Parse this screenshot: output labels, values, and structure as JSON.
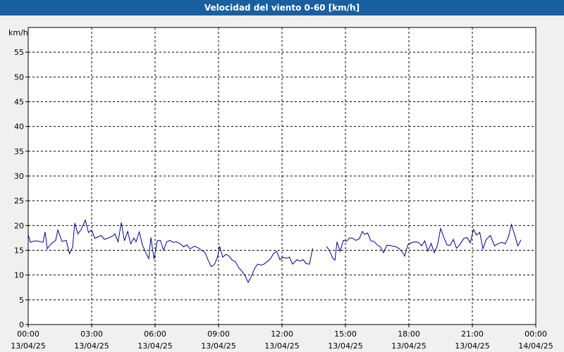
{
  "window": {
    "title": "Velocidad del viento 0-60 [km/h]"
  },
  "colors": {
    "title_bar": "#1a5fa0",
    "plot_bg": "#ffffff",
    "page_bg": "#f0f0f0",
    "series": "#00008b",
    "grid": "#000000"
  },
  "chart_data": {
    "type": "line",
    "title": "Velocidad del viento 0-60 [km/h]",
    "ylabel": "km/h",
    "ylim": [
      0,
      60
    ],
    "yticks": [
      0,
      5,
      10,
      15,
      20,
      25,
      30,
      35,
      40,
      45,
      50,
      55
    ],
    "xlim": [
      0,
      24
    ],
    "xticks": [
      {
        "time": "00:00",
        "date": "13/04/25"
      },
      {
        "time": "03:00",
        "date": "13/04/25"
      },
      {
        "time": "06:00",
        "date": "13/04/25"
      },
      {
        "time": "09:00",
        "date": "13/04/25"
      },
      {
        "time": "12:00",
        "date": "13/04/25"
      },
      {
        "time": "15:00",
        "date": "13/04/25"
      },
      {
        "time": "18:00",
        "date": "13/04/25"
      },
      {
        "time": "21:00",
        "date": "13/04/25"
      },
      {
        "time": "00:00",
        "date": "14/04/25"
      }
    ],
    "grid": true,
    "series": [
      {
        "segments": [
          [
            [
              0.0,
              18.2
            ],
            [
              0.1,
              16.6
            ],
            [
              0.3,
              16.9
            ],
            [
              0.5,
              16.8
            ],
            [
              0.7,
              16.6
            ],
            [
              0.8,
              18.7
            ],
            [
              0.9,
              15.3
            ],
            [
              1.1,
              16.4
            ],
            [
              1.3,
              17.0
            ],
            [
              1.4,
              19.1
            ],
            [
              1.6,
              16.8
            ],
            [
              1.8,
              17.0
            ],
            [
              1.95,
              14.3
            ],
            [
              2.1,
              15.6
            ],
            [
              2.2,
              20.5
            ],
            [
              2.35,
              18.3
            ],
            [
              2.5,
              19.2
            ],
            [
              2.7,
              21.1
            ],
            [
              2.85,
              18.6
            ],
            [
              3.0,
              19.1
            ],
            [
              3.15,
              17.4
            ],
            [
              3.3,
              17.7
            ],
            [
              3.45,
              18.0
            ],
            [
              3.6,
              17.2
            ],
            [
              3.8,
              17.5
            ],
            [
              4.0,
              17.9
            ],
            [
              4.1,
              18.3
            ],
            [
              4.25,
              16.7
            ],
            [
              4.4,
              20.6
            ],
            [
              4.55,
              16.9
            ],
            [
              4.7,
              18.8
            ],
            [
              4.85,
              16.3
            ],
            [
              5.0,
              17.5
            ],
            [
              5.1,
              16.7
            ],
            [
              5.25,
              18.7
            ],
            [
              5.4,
              16.1
            ],
            [
              5.55,
              14.6
            ],
            [
              5.7,
              13.3
            ],
            [
              5.8,
              17.6
            ],
            [
              5.95,
              13.2
            ],
            [
              6.1,
              16.9
            ],
            [
              6.25,
              17.0
            ],
            [
              6.4,
              15.0
            ],
            [
              6.55,
              16.7
            ],
            [
              6.7,
              17.0
            ],
            [
              6.85,
              16.6
            ],
            [
              7.0,
              16.7
            ],
            [
              7.2,
              16.3
            ],
            [
              7.35,
              15.7
            ],
            [
              7.5,
              16.1
            ],
            [
              7.65,
              15.3
            ],
            [
              7.85,
              15.8
            ],
            [
              8.0,
              15.6
            ],
            [
              8.2,
              15.0
            ],
            [
              8.35,
              14.6
            ],
            [
              8.5,
              13.1
            ],
            [
              8.65,
              11.7
            ],
            [
              8.8,
              12.1
            ],
            [
              8.95,
              13.6
            ],
            [
              9.05,
              15.8
            ],
            [
              9.2,
              13.6
            ],
            [
              9.35,
              14.2
            ],
            [
              9.5,
              13.8
            ],
            [
              9.65,
              13.0
            ],
            [
              9.8,
              12.7
            ],
            [
              9.95,
              11.5
            ],
            [
              10.1,
              10.8
            ],
            [
              10.25,
              9.9
            ],
            [
              10.4,
              8.5
            ],
            [
              10.55,
              9.7
            ],
            [
              10.7,
              11.3
            ],
            [
              10.85,
              12.2
            ],
            [
              11.0,
              12.0
            ],
            [
              11.15,
              12.2
            ],
            [
              11.3,
              12.7
            ],
            [
              11.45,
              13.3
            ],
            [
              11.6,
              14.3
            ],
            [
              11.75,
              14.8
            ],
            [
              11.9,
              13.1
            ],
            [
              12.05,
              13.6
            ],
            [
              12.2,
              13.4
            ],
            [
              12.35,
              13.6
            ],
            [
              12.5,
              12.2
            ],
            [
              12.7,
              13.1
            ],
            [
              12.85,
              12.8
            ],
            [
              13.0,
              13.1
            ],
            [
              13.15,
              12.3
            ],
            [
              13.3,
              12.2
            ],
            [
              13.45,
              15.4
            ]
          ],
          [
            [
              14.1,
              15.8
            ],
            [
              14.25,
              14.9
            ],
            [
              14.4,
              13.4
            ],
            [
              14.5,
              13.0
            ],
            [
              14.6,
              16.7
            ],
            [
              14.75,
              14.8
            ],
            [
              14.9,
              17.0
            ],
            [
              15.05,
              16.8
            ],
            [
              15.2,
              17.5
            ],
            [
              15.35,
              17.4
            ],
            [
              15.5,
              17.0
            ],
            [
              15.65,
              17.3
            ],
            [
              15.8,
              18.8
            ],
            [
              15.9,
              18.2
            ],
            [
              16.05,
              18.5
            ],
            [
              16.2,
              16.9
            ],
            [
              16.35,
              16.8
            ],
            [
              16.5,
              16.1
            ],
            [
              16.65,
              15.7
            ],
            [
              16.8,
              14.5
            ],
            [
              16.95,
              16.0
            ],
            [
              17.1,
              16.0
            ],
            [
              17.25,
              15.8
            ],
            [
              17.4,
              15.7
            ],
            [
              17.55,
              15.3
            ],
            [
              17.7,
              14.6
            ],
            [
              17.8,
              13.8
            ],
            [
              17.95,
              16.1
            ],
            [
              18.1,
              16.5
            ],
            [
              18.3,
              16.7
            ],
            [
              18.45,
              16.6
            ],
            [
              18.6,
              15.9
            ],
            [
              18.75,
              16.9
            ],
            [
              18.9,
              14.8
            ],
            [
              19.05,
              16.4
            ],
            [
              19.2,
              14.5
            ],
            [
              19.35,
              16.0
            ],
            [
              19.5,
              19.4
            ],
            [
              19.65,
              17.6
            ],
            [
              19.8,
              16.1
            ],
            [
              19.95,
              16.0
            ],
            [
              20.1,
              17.2
            ],
            [
              20.25,
              15.4
            ],
            [
              20.4,
              16.1
            ],
            [
              20.6,
              17.4
            ],
            [
              20.75,
              17.6
            ],
            [
              20.9,
              16.5
            ],
            [
              21.05,
              19.2
            ],
            [
              21.2,
              18.1
            ],
            [
              21.35,
              18.6
            ],
            [
              21.5,
              15.3
            ],
            [
              21.65,
              17.1
            ],
            [
              21.85,
              18.0
            ],
            [
              22.05,
              15.9
            ],
            [
              22.2,
              16.3
            ],
            [
              22.4,
              16.6
            ],
            [
              22.55,
              16.3
            ],
            [
              22.7,
              17.6
            ],
            [
              22.85,
              20.2
            ],
            [
              23.0,
              18.1
            ],
            [
              23.15,
              15.9
            ],
            [
              23.3,
              17.1
            ]
          ]
        ]
      }
    ]
  }
}
